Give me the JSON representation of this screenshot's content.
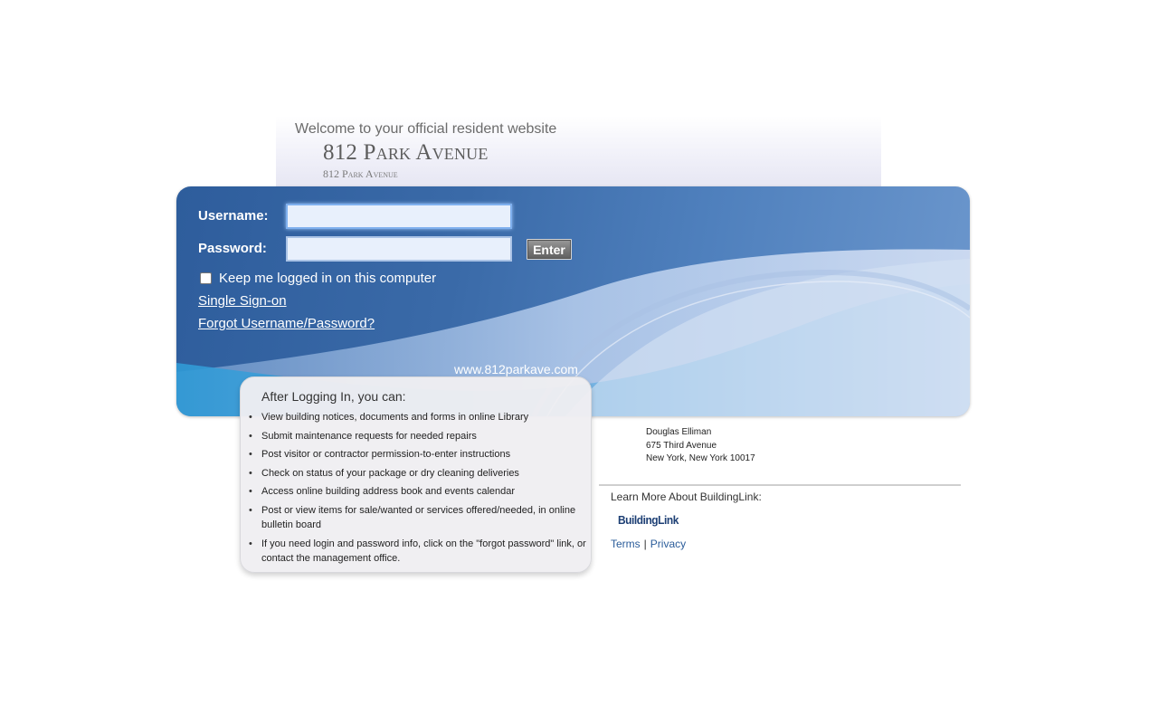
{
  "header": {
    "welcome": "Welcome to your official resident website",
    "building_name": "812 Park Avenue",
    "building_subname": "812 Park Avenue"
  },
  "login": {
    "username_label": "Username:",
    "password_label": "Password:",
    "username_value": "",
    "password_value": "",
    "enter_label": "Enter",
    "keep_logged_in": "Keep me logged in on this computer",
    "keep_logged_in_checked": false,
    "sso_link": "Single Sign-on",
    "forgot_link": "Forgot Username/Password?",
    "site_url": "www.812parkave.com"
  },
  "after_login": {
    "title": "After Logging In, you can:",
    "items": [
      "View building notices, documents and forms in online Library",
      "Submit maintenance requests for needed repairs",
      "Post visitor or contractor permission-to-enter instructions",
      "Check on status of your package or dry cleaning deliveries",
      "Access online building address book and events calendar",
      "Post or view items for sale/wanted or services offered/needed, in online bulletin board",
      "If you need login and password info, click on the \"forgot password\" link, or contact the management office."
    ]
  },
  "management": {
    "company": "Douglas Elliman",
    "address1": "675 Third Avenue",
    "address2": "New York, New York 10017"
  },
  "footer": {
    "learn_more": "Learn More About BuildingLink:",
    "logo_text": "BuildingLink",
    "terms": "Terms",
    "separator": "|",
    "privacy": "Privacy"
  },
  "colors": {
    "panel_blue": "#3a6aa8",
    "link_blue": "#2a5c9a"
  }
}
